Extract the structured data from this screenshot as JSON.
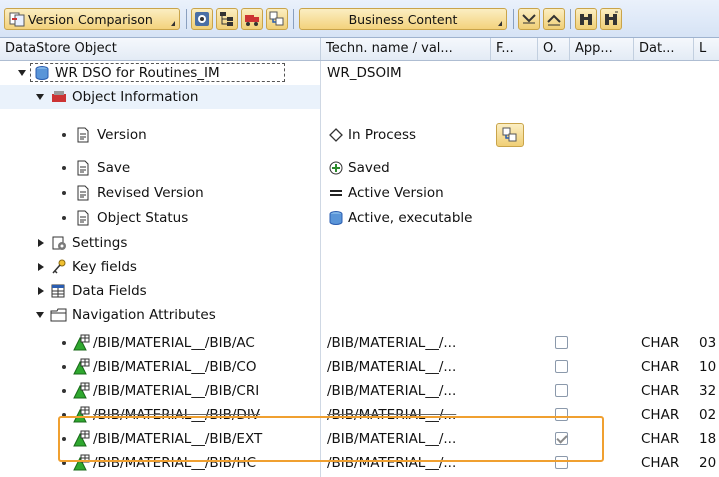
{
  "toolbar": {
    "version_comparison": "Version Comparison",
    "business_content": "Business Content"
  },
  "columns": {
    "object": "DataStore Object",
    "techname": "Techn. name / val...",
    "f": "F...",
    "o": "O.",
    "app": "App...",
    "dat": "Dat...",
    "l": "L"
  },
  "root": {
    "label": "WR DSO for Routines_IM",
    "tech": "WR_DSOIM"
  },
  "object_information": {
    "label": "Object Information",
    "items": [
      {
        "label": "Version",
        "value": "In Process"
      },
      {
        "label": "Save",
        "value": "Saved"
      },
      {
        "label": "Revised Version",
        "value": "Active Version"
      },
      {
        "label": "Object Status",
        "value": "Active, executable"
      }
    ]
  },
  "nodes": {
    "settings": "Settings",
    "key_fields": "Key fields",
    "data_fields": "Data Fields",
    "navigation_attributes": "Navigation Attributes"
  },
  "nav_attributes": [
    {
      "name": "/BIB/MATERIAL__/BIB/AC",
      "tech": "/BIB/MATERIAL__/...",
      "checked": false,
      "type": "CHAR",
      "len": "03"
    },
    {
      "name": "/BIB/MATERIAL__/BIB/CO",
      "tech": "/BIB/MATERIAL__/...",
      "checked": false,
      "type": "CHAR",
      "len": "10"
    },
    {
      "name": "/BIB/MATERIAL__/BIB/CRI",
      "tech": "/BIB/MATERIAL__/...",
      "checked": false,
      "type": "CHAR",
      "len": "32"
    },
    {
      "name": "/BIB/MATERIAL__/BIB/DIV",
      "tech": "/BIB/MATERIAL__/...",
      "checked": false,
      "type": "CHAR",
      "len": "02"
    },
    {
      "name": "/BIB/MATERIAL__/BIB/EXT",
      "tech": "/BIB/MATERIAL__/...",
      "checked": true,
      "type": "CHAR",
      "len": "18"
    },
    {
      "name": "/BIB/MATERIAL__/BIB/HC",
      "tech": "/BIB/MATERIAL__/...",
      "checked": false,
      "type": "CHAR",
      "len": "20"
    }
  ],
  "colors": {
    "accent_highlight": "#f0a030",
    "toolbar_bg": "#d6e3f5",
    "button_gold": "#f3d27c"
  }
}
